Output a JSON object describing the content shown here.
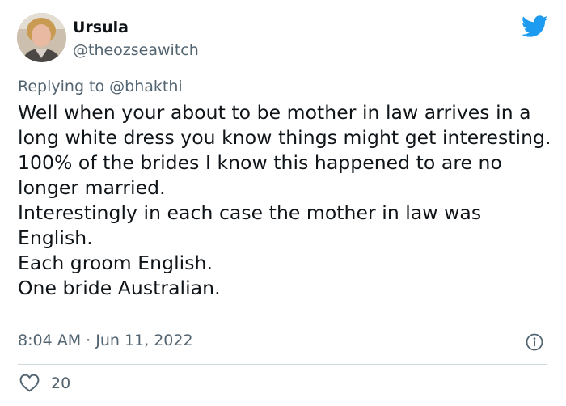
{
  "author": {
    "name": "Ursula",
    "handle": "@theozseawitch"
  },
  "reply": {
    "prefix": "Replying to ",
    "mention": "@bhakthi"
  },
  "tweet": {
    "lines": [
      "Well when your about to be mother in law arrives in a long white dress you know things might get interesting.",
      "100% of the brides I know this happened to are no longer married.",
      "Interestingly in each case the mother in law was English.",
      "Each groom English.",
      "One bride Australian."
    ],
    "timestamp": "8:04 AM · Jun 11, 2022"
  },
  "engagement": {
    "likes": "20"
  },
  "icons": {
    "brand": "twitter-bird-icon",
    "info": "info-icon",
    "like": "heart-icon"
  },
  "colors": {
    "brand": "#1d9bf0",
    "text": "#0f1419",
    "muted": "#536471",
    "divider": "#cfd9de"
  }
}
